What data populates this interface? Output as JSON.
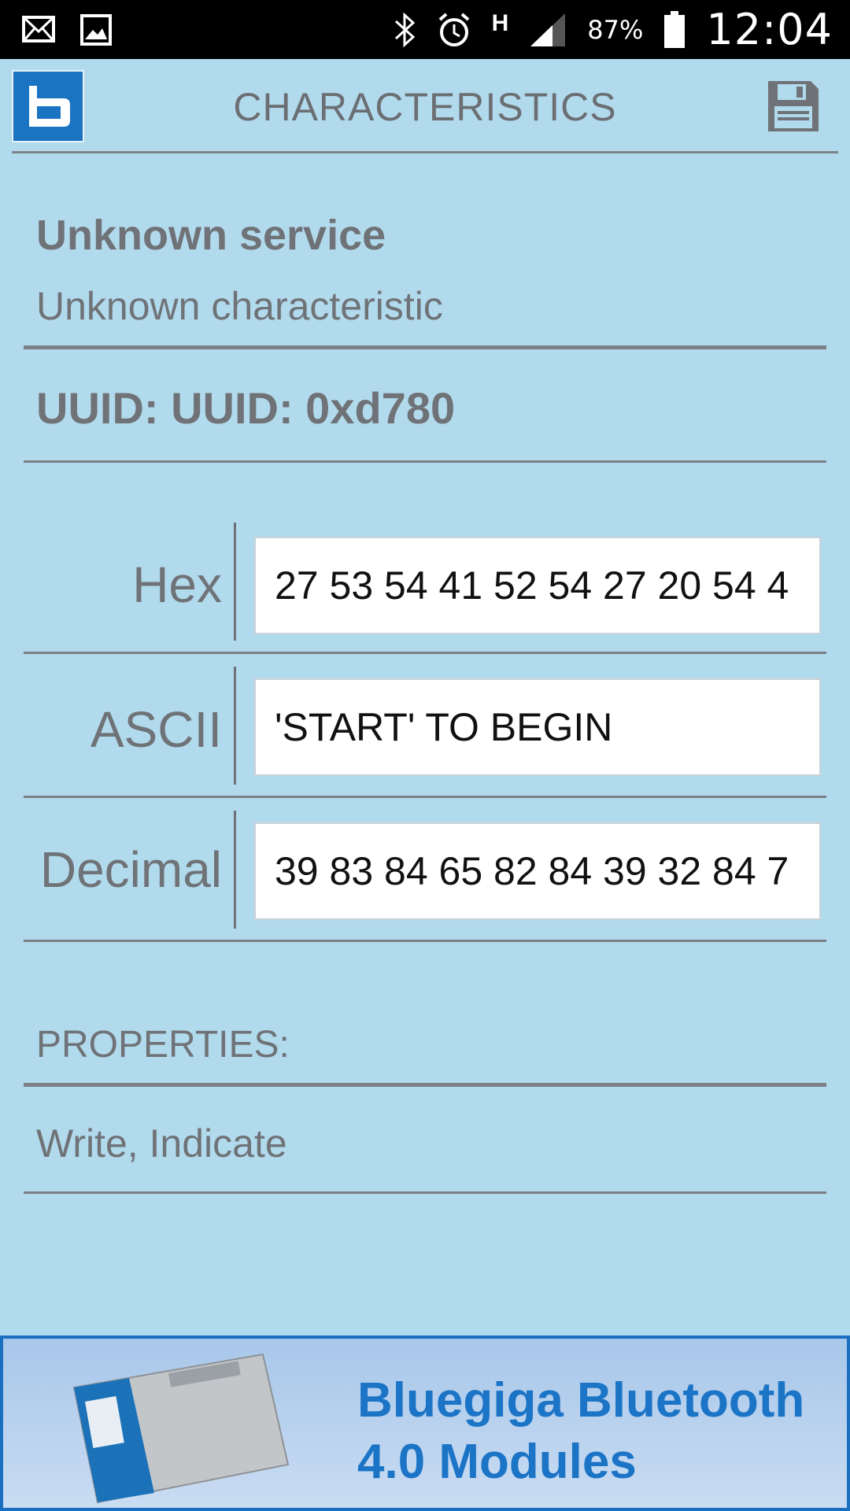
{
  "status_bar": {
    "battery": "87%",
    "time": "12:04",
    "network_type": "H"
  },
  "header": {
    "title": "CHARACTERISTICS",
    "logo_letter": "b"
  },
  "service": {
    "name": "Unknown service",
    "characteristic": "Unknown characteristic",
    "uuid": "UUID: UUID: 0xd780"
  },
  "values": {
    "hex_label": "Hex",
    "hex_value": "27 53 54 41 52 54 27 20 54 4",
    "ascii_label": "ASCII",
    "ascii_value": "'START' TO BEGIN",
    "decimal_label": "Decimal",
    "decimal_value": "39 83 84 65 82 84 39 32 84 7"
  },
  "properties": {
    "label": "PROPERTIES:",
    "value": "Write, Indicate"
  },
  "banner": {
    "line1": "Bluegiga Bluetooth",
    "line2": "4.0 Modules",
    "colors": {
      "text": "#1b74c6",
      "border": "#1a6fc0"
    }
  },
  "colors": {
    "background": "#b2daed",
    "text_gray": "#6f7377",
    "brand_blue": "#1a74c2"
  }
}
